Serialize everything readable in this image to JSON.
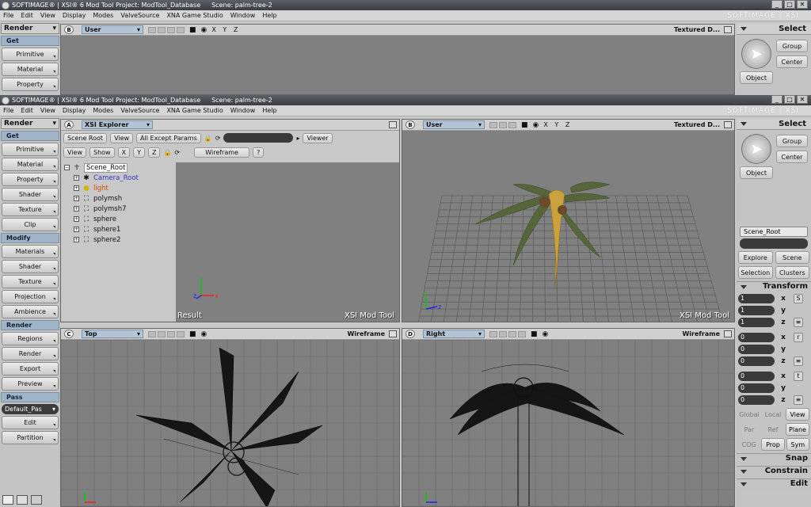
{
  "top_window": {
    "title": "SOFTIMAGE® | XSI® 6 Mod Tool Project: ModTool_Database",
    "scene": "Scene: palm-tree-2",
    "menu": [
      "File",
      "Edit",
      "View",
      "Display",
      "Modes",
      "ValveSource",
      "XNA Game Studio",
      "Window",
      "Help"
    ],
    "brand": "SOFTIMAGE | XSI",
    "left": {
      "header": "Render",
      "section": "Get",
      "buttons": [
        "Primitive",
        "Material",
        "Property"
      ]
    },
    "viewport": {
      "letter": "B",
      "camera": "User",
      "mode": "Textured D...",
      "axes": "X Y Z"
    },
    "right": {
      "header": "Select",
      "group": "Group",
      "center": "Center",
      "object": "Object"
    }
  },
  "main_window": {
    "title": "SOFTIMAGE® | XSI® 6 Mod Tool Project: ModTool_Database",
    "scene": "Scene: palm-tree-2",
    "menu": [
      "File",
      "Edit",
      "View",
      "Display",
      "Modes",
      "ValveSource",
      "XNA Game Studio",
      "Window",
      "Help"
    ],
    "brand": "SOFTIMAGE | XSI"
  },
  "left_panel": {
    "header": "Render",
    "sections": [
      {
        "title": "Get",
        "buttons": [
          "Primitive",
          "Material",
          "Property",
          "Shader",
          "Texture",
          "Clip"
        ]
      },
      {
        "title": "Modify",
        "buttons": [
          "Materials",
          "Shader",
          "Texture",
          "Projection",
          "Ambience"
        ]
      },
      {
        "title": "Render",
        "buttons": [
          "Regions",
          "Render",
          "Export",
          "Preview"
        ]
      },
      {
        "title": "Pass",
        "dropdown": "Default_Pas",
        "buttons": [
          "Edit",
          "Partition"
        ]
      }
    ]
  },
  "explorer": {
    "letter": "A",
    "title": "XSI Explorer",
    "toolbar1": {
      "scope": "Scene Root",
      "view": "View",
      "filter": "All Except Params",
      "viewer": "Viewer"
    },
    "toolbar2": {
      "view": "View",
      "show": "Show",
      "x": "X",
      "y": "Y",
      "z": "Z",
      "mode": "Wireframe",
      "help": "?"
    },
    "tree": [
      {
        "name": "Scene_Root",
        "root": true
      },
      {
        "name": "Camera_Root",
        "color": "#3333cc"
      },
      {
        "name": "light",
        "color": "#dd4400"
      },
      {
        "name": "polymsh"
      },
      {
        "name": "polymsh7"
      },
      {
        "name": "sphere"
      },
      {
        "name": "sphere1"
      },
      {
        "name": "sphere2"
      }
    ],
    "result_label": "Result",
    "watermark": "XSI Mod Tool"
  },
  "viewports": {
    "user": {
      "letter": "B",
      "camera": "User",
      "mode": "Textured D...",
      "axes": "X Y Z",
      "watermark": "XSI Mod Tool"
    },
    "top": {
      "letter": "C",
      "camera": "Top",
      "mode": "Wireframe"
    },
    "right": {
      "letter": "D",
      "camera": "Right",
      "mode": "Wireframe"
    }
  },
  "right_panel": {
    "select": {
      "header": "Select",
      "group": "Group",
      "center": "Center",
      "object": "Object"
    },
    "scene_field": "Scene_Root",
    "buttons1": [
      "Explore",
      "Scene"
    ],
    "buttons2": [
      "Selection",
      "Clusters"
    ],
    "transform": {
      "header": "Transform",
      "scale": [
        "1",
        "1",
        "1"
      ],
      "rotate": [
        "0",
        "0",
        "0"
      ],
      "translate": [
        "0",
        "0",
        "0"
      ],
      "axes": [
        "x",
        "y",
        "z"
      ]
    },
    "ref_row1": [
      "Global",
      "Local",
      "View"
    ],
    "ref_row2": [
      "Par",
      "Ref",
      "Plane"
    ],
    "ref_row3": [
      "COG",
      "Prop",
      "Sym"
    ],
    "bottom_bars": [
      "Snap",
      "Constrain",
      "Edit"
    ]
  }
}
